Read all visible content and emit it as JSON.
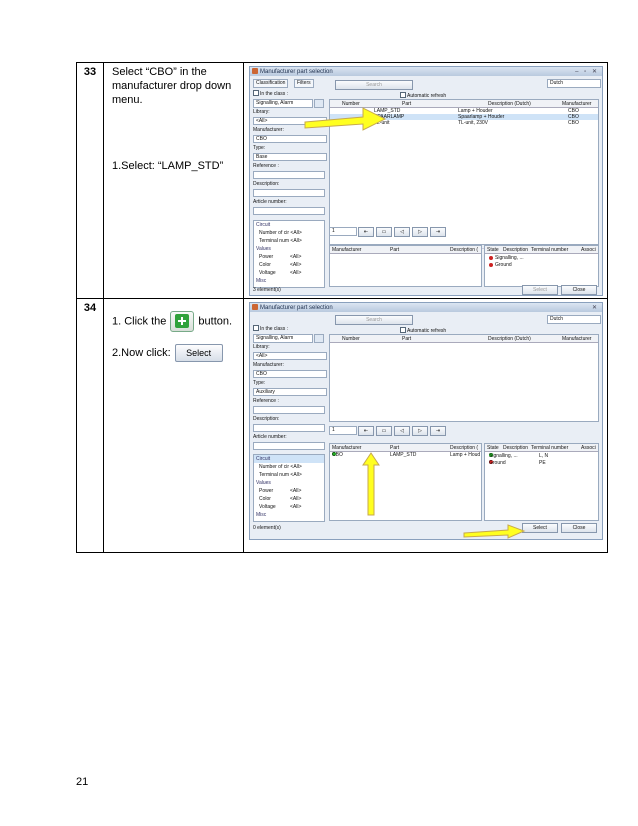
{
  "page_number": "21",
  "steps": [
    {
      "number": "33",
      "instruction": "Select “CBO” in the manufacturer drop down menu.",
      "instruction2": "1.Select: “LAMP_STD”",
      "dialog": {
        "title": "Manufacturer part selection",
        "tab_classification": "Classification",
        "tab_filters": "Filters",
        "search_label": "Search",
        "language": "Dutch",
        "in_class": "In the class :",
        "auto_refresh": "Automatic refresh",
        "class_value": "Signalling, Alarm",
        "library_label": "Library:",
        "library_value": "<All>",
        "manufacturer_label": "Manufacturer:",
        "manufacturer_value": "CBO",
        "type_label": "Type:",
        "type_value": "Base",
        "reference_label": "Reference :",
        "description_label": "Description:",
        "article_label": "Article number:",
        "columns": [
          "Number",
          "Part",
          "Description (Dutch)",
          "Manufacturer"
        ],
        "rows": [
          {
            "number": "LAMP_STD",
            "part": "Lamp + Houder",
            "manufacturer": "CBO"
          },
          {
            "number": "SPAARLAMP",
            "part": "Spaarlamp + Houder",
            "manufacturer": "CBO"
          },
          {
            "number": "TL-unit",
            "part": "TL-unit, 230V",
            "manufacturer": "CBO"
          }
        ],
        "lower_columns_left": [
          "Manufacturer",
          "Part",
          "Description ("
        ],
        "lower_columns_right": [
          "State",
          "Description",
          "Terminal number",
          "Associ"
        ],
        "state_rows": [
          "Signalling, ...",
          "Ground"
        ],
        "circuit_label": "Circuit",
        "circuit_items": [
          "Number of cir <All>",
          "Terminal num <All>"
        ],
        "values_label": "Values",
        "values_items": [
          "Power",
          "Color",
          "Voltage"
        ],
        "values_all": "<All>",
        "misc_label": "Misc",
        "page_value": "1",
        "element_count": "3 element(s)",
        "select_button": "Select",
        "close_button": "Close"
      }
    },
    {
      "number": "34",
      "instruction_pre": "1. Click the",
      "instruction_post": "button.",
      "instruction2": "2.Now click:",
      "select_label": "Select",
      "dialog": {
        "title": "Manufacturer part selection",
        "search_label": "Search",
        "language": "Dutch",
        "in_class": "In the class :",
        "auto_refresh": "Automatic refresh",
        "class_value": "Signalling, Alarm",
        "library_label": "Library:",
        "library_value": "<All>",
        "manufacturer_label": "Manufacturer:",
        "manufacturer_value": "CBO",
        "type_label": "Type:",
        "type_value": "Auxiliary",
        "reference_label": "Reference :",
        "description_label": "Description:",
        "article_label": "Article number:",
        "columns": [
          "Number",
          "Part",
          "Description (Dutch)",
          "Manufacturer"
        ],
        "lower_columns_left": [
          "Manufacturer",
          "Part",
          "Description ("
        ],
        "lower_columns_right": [
          "State",
          "Description",
          "Terminal number",
          "Associ"
        ],
        "lower_row": {
          "manufacturer": "CBO",
          "part": "LAMP_STD",
          "description": "Lamp + Houd"
        },
        "state_rows": [
          {
            "description": "Signalling, ...",
            "terminal": "L, N"
          },
          {
            "description": "Ground",
            "terminal": "PE"
          }
        ],
        "circuit_label": "Circuit",
        "circuit_items": [
          "Number of cir <All>",
          "Terminal num <All>"
        ],
        "values_label": "Values",
        "values_items": [
          "Power",
          "Color",
          "Voltage"
        ],
        "values_all": "<All>",
        "misc_label": "Misc",
        "page_value": "1",
        "element_count": "0 element(s)",
        "select_button": "Select",
        "close_button": "Close"
      }
    }
  ]
}
